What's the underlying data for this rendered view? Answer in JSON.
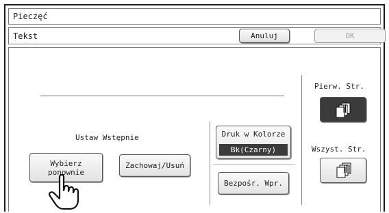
{
  "window": {
    "title": "Pieczęć"
  },
  "toolbar": {
    "label": "Tekst",
    "cancel_label": "Anuluj",
    "ok_label": "OK"
  },
  "preset": {
    "label": "Ustaw Wstępnie",
    "reselect_label_line1": "Wybierz",
    "reselect_label_line2": "ponownie",
    "save_delete_label": "Zachowaj/Usuń"
  },
  "color_print": {
    "label": "Druk w Kolorze",
    "value": "Bk(Czarny)"
  },
  "direct_entry": {
    "label": "Bezpośr. Wpr."
  },
  "pages": {
    "first_label": "Pierw. Str.",
    "all_label": "Wszyst. Str.",
    "selected": "first"
  },
  "colors": {
    "dark_fill": "#3b3b3b",
    "border": "#1a1a1a"
  },
  "icons": {
    "first_page": "page-stack-icon",
    "all_pages": "multi-page-stack-icon",
    "pointer": "hand-pointer-icon"
  }
}
